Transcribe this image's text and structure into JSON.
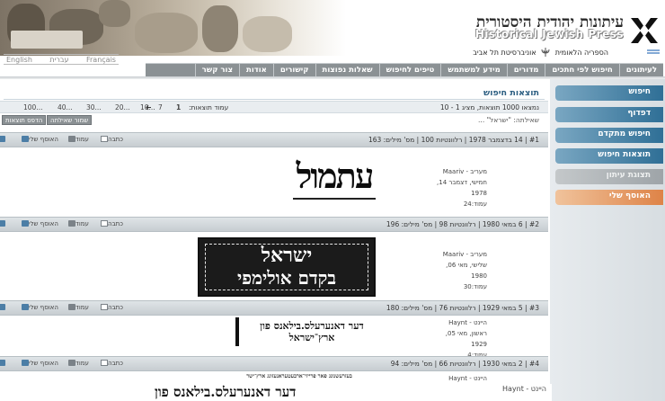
{
  "header": {
    "title_he": "עיתונות יהודית היסטורית",
    "title_en": "Historical Jewish Press",
    "institution_nli": "הספריה הלאומית",
    "institution_tau": "אוניברסיטת תל אביב"
  },
  "languages": [
    "English",
    "עברית",
    "Français"
  ],
  "nav": [
    "לעיתונים",
    "חיפוש לפי חתכים",
    "מדורים",
    "מידע למשתמש",
    "טיפים לחיפוש",
    "שאלות נפוצות",
    "קישורים",
    "אודות",
    "צור קשר"
  ],
  "sidebar": [
    {
      "label": "חיפוש",
      "style": "search"
    },
    {
      "label": "דפדוף",
      "style": "search"
    },
    {
      "label": "חיפוש מתקדם",
      "style": "search"
    },
    {
      "label": "תוצאות חיפוש",
      "style": "search"
    },
    {
      "label": "תצוגת עיתון",
      "style": "disabled"
    },
    {
      "label": "האוסף שלי",
      "style": "coll"
    }
  ],
  "results": {
    "title": "תוצאות חיפוש",
    "info": "נמצאו 1000 תוצאות, מציג 1 - 10",
    "page_label": "עמוד תוצאות:",
    "pages": [
      "1",
      "7",
      "10...",
      "20...",
      "30...",
      "40...",
      "100..."
    ],
    "query": "שאילתה: \"ישראל\" ...",
    "btn_save_query": "שמור שאילתה",
    "btn_print_results": "הדפס תוצאות",
    "actions": {
      "collection": "האוסף שלי",
      "page": "עמוד",
      "article": "כתבה"
    },
    "items": [
      {
        "header": "#1 | 14 בדצמבר 1978 | רלוונטיות 100 | מס' מילים: 163",
        "source_he": "מעריב -",
        "source_en": "Maariv",
        "day": "חמישי, דצמבר 14,",
        "year": "1978",
        "page": "עמוד:24",
        "clip_text": "עתמול"
      },
      {
        "header": "#2 | 6 במאי 1980 | רלוונטיות 98 | מס' מילים: 196",
        "source_he": "מעריב -",
        "source_en": "Maariv",
        "day": "שלישי, מאי 06,",
        "year": "1980",
        "page": "עמוד:30",
        "clip_text_1": "ישראל",
        "clip_text_2": "בקדם אולימפי"
      },
      {
        "header": "#3 | 5 במאי 1929 | רלוונטיות 76 | מס' מילים: 180",
        "source_he": "היינט -",
        "source_en": "Haynt",
        "day": "ראשון, מאי 05,",
        "year": "1929",
        "page": "עמוד:4",
        "clip_text_1": "דער דאנערעלס.בילאנס פון",
        "clip_text_2": "ארץ־ישראל"
      },
      {
        "header": "#4 | 2 במאי 1930 | רלוונטיות 66 | מס' מילים: 94",
        "source_he": "היינט -",
        "source_en": "Haynt",
        "clip_text_1": "בעזרעשנונג פאר פרייזי־ארבעטעראנעזונג ארץ־ישר",
        "clip_text_2": "דער דאנערעלס.בילאנס פון"
      }
    ]
  }
}
